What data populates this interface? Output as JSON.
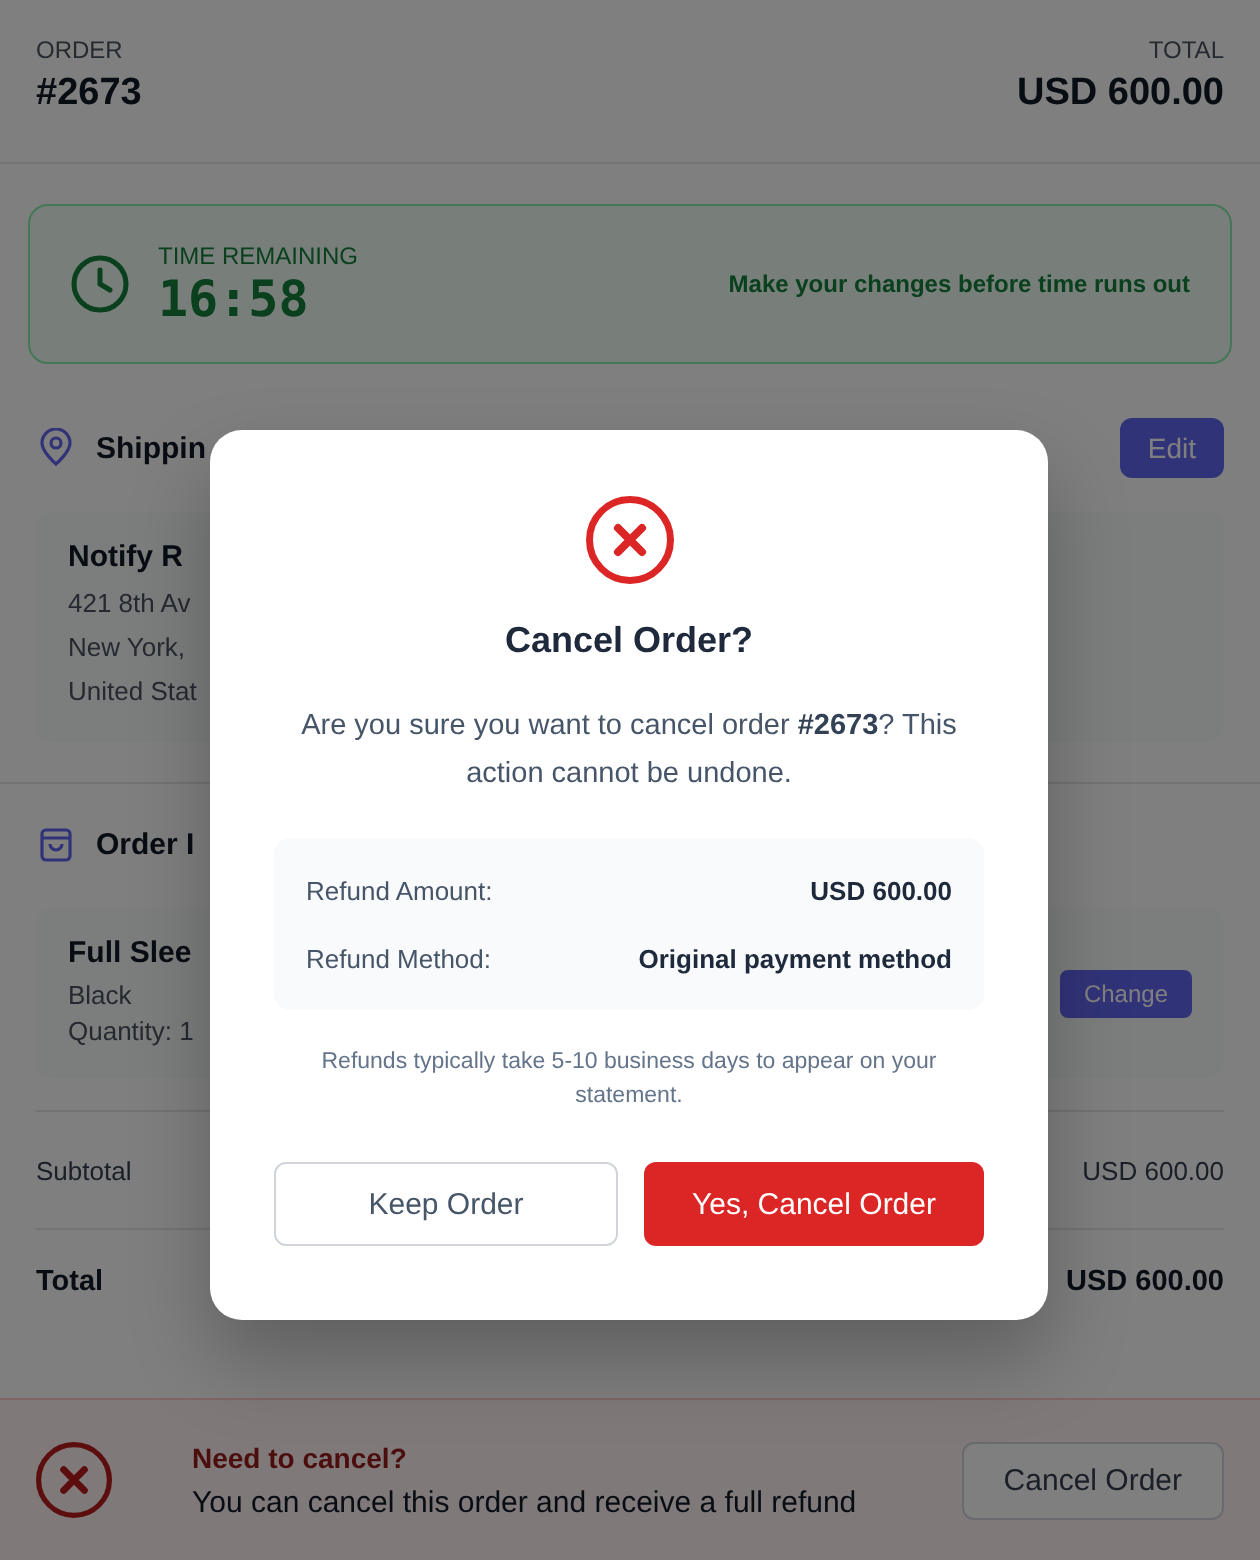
{
  "header": {
    "order_label": "ORDER",
    "order_number": "#2673",
    "total_label": "TOTAL",
    "total": "USD 600.00"
  },
  "timer": {
    "label": "TIME REMAINING",
    "time": "16:58",
    "hint": "Make your changes before time runs out"
  },
  "shipping": {
    "title": "Shippin",
    "edit_button": "Edit",
    "name": "Notify R",
    "address_lines": [
      "421 8th Av",
      "New York,",
      "United Stat"
    ]
  },
  "order_items": {
    "title": "Order I",
    "items": [
      {
        "name": "Full Slee",
        "variant": "Black",
        "quantity": "Quantity: 1",
        "change_button": "Change"
      }
    ]
  },
  "summary": [
    {
      "label": "Subtotal",
      "value": "USD 600.00",
      "kind": "subtotal"
    },
    {
      "label": "Total",
      "value": "USD 600.00",
      "kind": "total"
    }
  ],
  "cancel_banner": {
    "title": "Need to cancel?",
    "text": "You can cancel this order and receive a full refund",
    "button": "Cancel Order"
  },
  "dialog": {
    "title": "Cancel Order?",
    "message": "Are you sure you want to cancel order **#2673**? This action cannot be undone.",
    "refund_rows": [
      {
        "label": "Refund Amount:",
        "value": "USD 600.00"
      },
      {
        "label": "Refund Method:",
        "value": "Original payment method"
      }
    ],
    "note": "Refunds typically take 5-10 business days to appear on your statement.",
    "buttons": [
      {
        "label": "Keep Order",
        "kind": "secondary"
      },
      {
        "label": "Yes, Cancel Order",
        "kind": "danger"
      }
    ]
  }
}
